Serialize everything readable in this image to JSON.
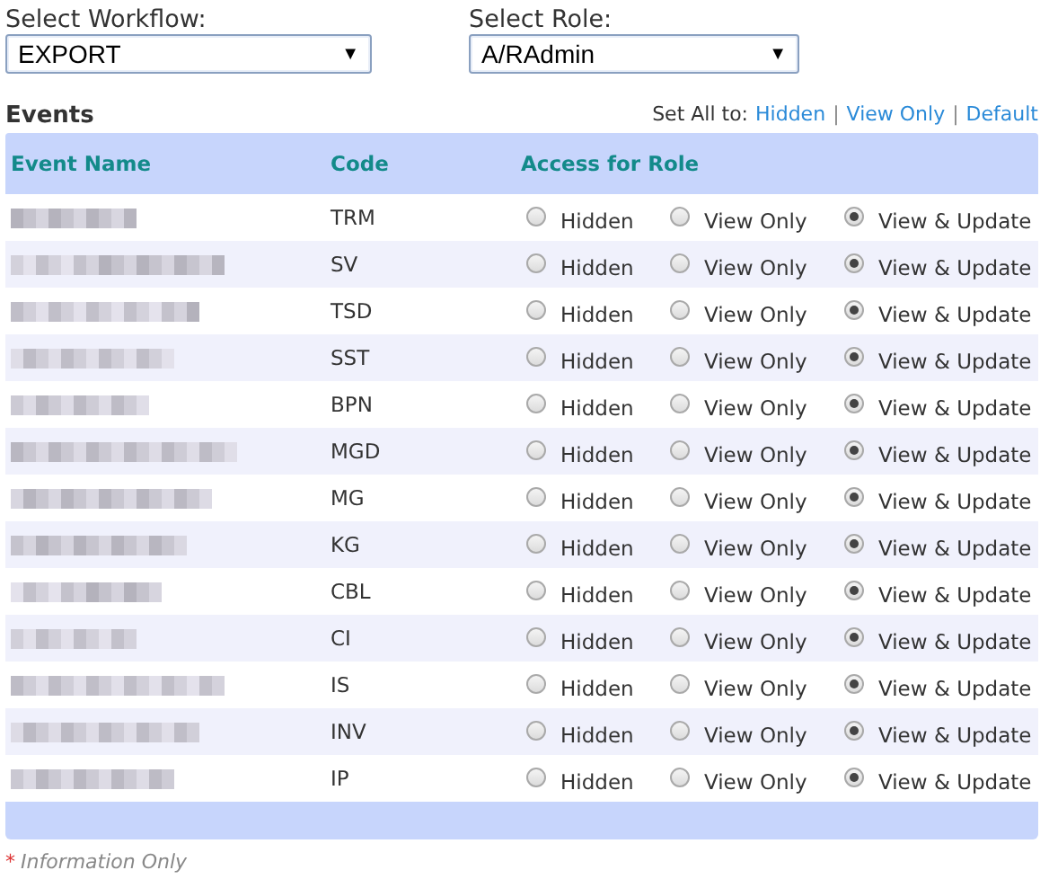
{
  "workflow": {
    "label": "Select Workflow:",
    "value": "EXPORT",
    "caret": "▼"
  },
  "role": {
    "label": "Select Role:",
    "value": "A/RAdmin",
    "caret": "▼"
  },
  "events": {
    "title": "Events",
    "set_all": {
      "label": "Set All to:",
      "links": [
        "Hidden",
        "View Only",
        "Default"
      ],
      "separator": "|"
    },
    "columns": [
      "Event Name",
      "Code",
      "Access for Role"
    ],
    "rows": [
      {
        "code": "TRM",
        "options": [
          {
            "label": "Hidden",
            "selected": false
          },
          {
            "label": "View Only",
            "selected": false
          },
          {
            "label": "View & Update",
            "selected": true
          }
        ]
      },
      {
        "code": "SV",
        "options": [
          {
            "label": "Hidden",
            "selected": false
          },
          {
            "label": "View Only",
            "selected": false
          },
          {
            "label": "View & Update",
            "selected": true
          }
        ]
      },
      {
        "code": "TSD",
        "options": [
          {
            "label": "Hidden",
            "selected": false
          },
          {
            "label": "View Only",
            "selected": false
          },
          {
            "label": "View & Update",
            "selected": true
          }
        ]
      },
      {
        "code": "SST",
        "options": [
          {
            "label": "Hidden",
            "selected": false
          },
          {
            "label": "View Only",
            "selected": false
          },
          {
            "label": "View & Update",
            "selected": true
          }
        ]
      },
      {
        "code": "BPN",
        "options": [
          {
            "label": "Hidden",
            "selected": false
          },
          {
            "label": "View Only",
            "selected": false
          },
          {
            "label": "View & Update",
            "selected": true
          }
        ]
      },
      {
        "code": "MGD",
        "options": [
          {
            "label": "Hidden",
            "selected": false
          },
          {
            "label": "View Only",
            "selected": false
          },
          {
            "label": "View & Update",
            "selected": true
          }
        ]
      },
      {
        "code": "MG",
        "options": [
          {
            "label": "Hidden",
            "selected": false
          },
          {
            "label": "View Only",
            "selected": false
          },
          {
            "label": "View & Update",
            "selected": true
          }
        ]
      },
      {
        "code": "KG",
        "options": [
          {
            "label": "Hidden",
            "selected": false
          },
          {
            "label": "View Only",
            "selected": false
          },
          {
            "label": "View & Update",
            "selected": true
          }
        ]
      },
      {
        "code": "CBL",
        "options": [
          {
            "label": "Hidden",
            "selected": false
          },
          {
            "label": "View Only",
            "selected": false
          },
          {
            "label": "View & Update",
            "selected": true
          }
        ]
      },
      {
        "code": "CI",
        "options": [
          {
            "label": "Hidden",
            "selected": false
          },
          {
            "label": "View Only",
            "selected": false
          },
          {
            "label": "View & Update",
            "selected": true
          }
        ]
      },
      {
        "code": "IS",
        "options": [
          {
            "label": "Hidden",
            "selected": false
          },
          {
            "label": "View Only",
            "selected": false
          },
          {
            "label": "View & Update",
            "selected": true
          }
        ]
      },
      {
        "code": "INV",
        "options": [
          {
            "label": "Hidden",
            "selected": false
          },
          {
            "label": "View Only",
            "selected": false
          },
          {
            "label": "View & Update",
            "selected": true
          }
        ]
      },
      {
        "code": "IP",
        "options": [
          {
            "label": "Hidden",
            "selected": false
          },
          {
            "label": "View Only",
            "selected": false
          },
          {
            "label": "View & Update",
            "selected": true
          }
        ]
      }
    ]
  },
  "footnote": {
    "mark": "*",
    "text": "Information Only"
  }
}
